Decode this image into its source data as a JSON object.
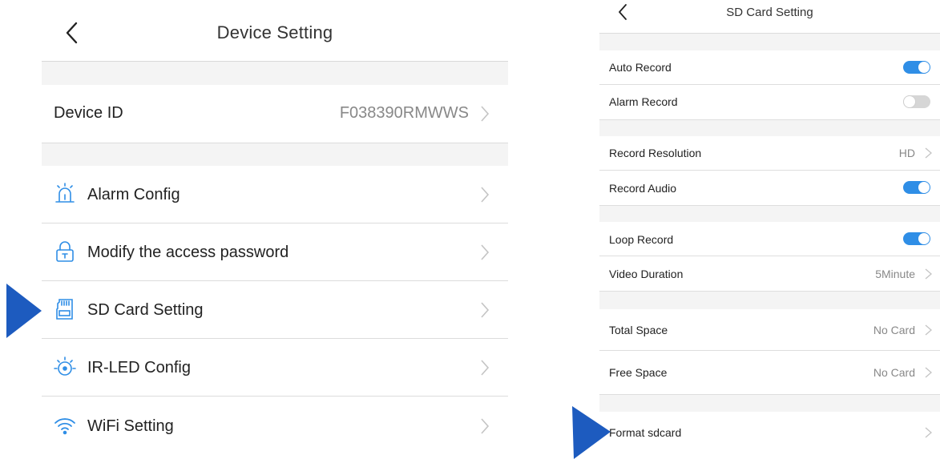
{
  "left": {
    "title": "Device Setting",
    "device_id": {
      "label": "Device ID",
      "value": "F038390RMWWS"
    },
    "items": [
      {
        "label": "Alarm Config",
        "icon": "alarm-icon"
      },
      {
        "label": "Modify the access password",
        "icon": "lock-icon"
      },
      {
        "label": "SD Card Setting",
        "icon": "sd-card-icon"
      },
      {
        "label": "IR-LED Config",
        "icon": "ir-led-icon"
      },
      {
        "label": "WiFi Setting",
        "icon": "wifi-icon"
      }
    ]
  },
  "right": {
    "title": "SD Card Setting",
    "auto_record": {
      "label": "Auto Record",
      "on": true
    },
    "alarm_record": {
      "label": "Alarm Record",
      "on": false
    },
    "record_resolution": {
      "label": "Record Resolution",
      "value": "HD"
    },
    "record_audio": {
      "label": "Record Audio",
      "on": true
    },
    "loop_record": {
      "label": "Loop Record",
      "on": true
    },
    "video_duration": {
      "label": "Video Duration",
      "value": "5Minute"
    },
    "total_space": {
      "label": "Total Space",
      "value": "No Card"
    },
    "free_space": {
      "label": "Free Space",
      "value": "No Card"
    },
    "format": {
      "label": "Format sdcard"
    }
  },
  "colors": {
    "accent": "#2f8ee6",
    "pointer": "#1d5bbf",
    "separator": "#f4f4f4"
  }
}
